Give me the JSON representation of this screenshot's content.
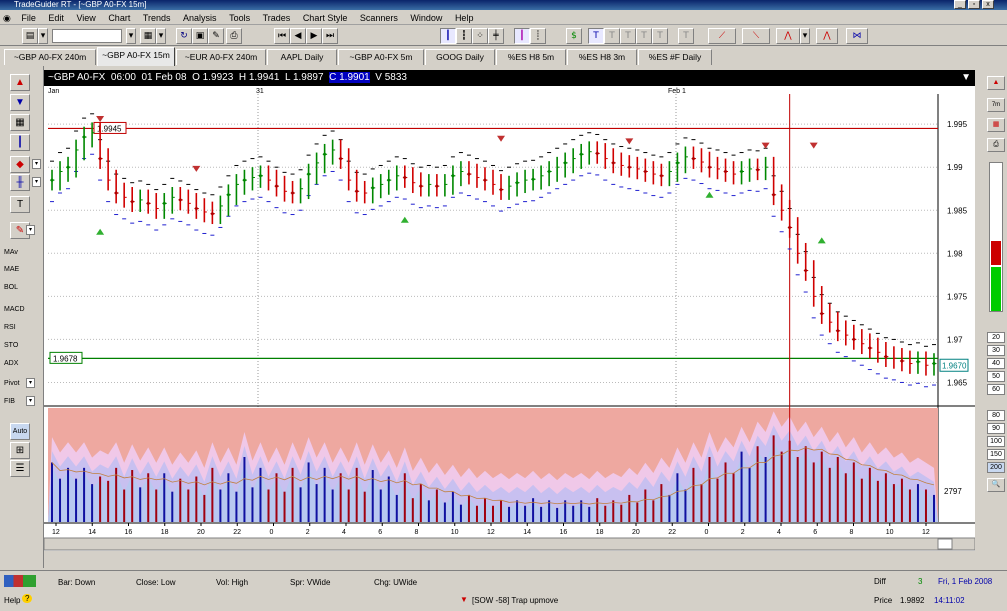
{
  "window": {
    "title": "TradeGuider RT - [~GBP A0-FX 15m]",
    "minimize": "_",
    "restore": "▫",
    "close": "x"
  },
  "menu": [
    "File",
    "Edit",
    "View",
    "Chart",
    "Trends",
    "Analysis",
    "Tools",
    "Trades",
    "Chart Style",
    "Scanners",
    "Window",
    "Help"
  ],
  "toolbar": {
    "symbol_value": ""
  },
  "tabs": [
    "~GBP A0-FX 240m",
    "~GBP A0-FX 15m",
    "~EUR A0-FX 240m",
    "AAPL Daily",
    "~GBP A0-FX 5m",
    "GOOG Daily",
    "%ES H8 5m",
    "%ES H8 3m",
    "%ES #F Daily"
  ],
  "active_tab": 1,
  "left_panel": {
    "items": [
      "MAv",
      "MAE",
      "BOL",
      "MACD",
      "RSI",
      "STO",
      "ADX",
      "Pivot",
      "FIB",
      "Auto"
    ]
  },
  "chart_header": {
    "symbol": "~GBP A0-FX",
    "time": "06:00",
    "date": "01 Feb 08",
    "open": "O 1.9923",
    "high": "H 1.9941",
    "low": "L 1.9897",
    "close": "C 1.9901",
    "volume": "V 5833"
  },
  "right_panel": {
    "zoom_label": "7m",
    "numbers_top": [
      "20",
      "30",
      "40",
      "50",
      "60"
    ],
    "numbers_bottom": [
      "80",
      "90",
      "100",
      "150",
      "200"
    ]
  },
  "chart_data": {
    "type": "candlestick",
    "date_labels": [
      "Jan",
      "31",
      "Feb 1"
    ],
    "x_ticks": [
      "12",
      "14",
      "16",
      "18",
      "20",
      "22",
      "0",
      "2",
      "4",
      "6",
      "8",
      "10",
      "12",
      "14",
      "16",
      "18",
      "20",
      "22",
      "0",
      "2",
      "4",
      "6",
      "8",
      "10",
      "12"
    ],
    "y_ticks": [
      "1.995",
      "1.99",
      "1.985",
      "1.98",
      "1.975",
      "1.97",
      "1.965"
    ],
    "ylim": [
      1.9625,
      1.9985
    ],
    "resistance": {
      "value": 1.9945,
      "label": "1.9945"
    },
    "support": {
      "value": 1.9678,
      "label": "1.9678"
    },
    "last_price_label": "1.9670",
    "volume_axis_label": "2797",
    "closes": [
      1.9885,
      1.9895,
      1.99,
      1.992,
      1.9935,
      1.994,
      1.991,
      1.9885,
      1.987,
      1.9865,
      1.986,
      1.9862,
      1.9858,
      1.9852,
      1.9858,
      1.9865,
      1.9862,
      1.9858,
      1.9852,
      1.9848,
      1.9846,
      1.9855,
      1.9868,
      1.988,
      1.9885,
      1.9888,
      1.989,
      1.9885,
      1.9878,
      1.9872,
      1.987,
      1.9875,
      1.9892,
      1.9905,
      1.9915,
      1.992,
      1.991,
      1.9885,
      1.9872,
      1.987,
      1.9876,
      1.988,
      1.9885,
      1.989,
      1.9888,
      1.9882,
      1.9878,
      1.988,
      1.9878,
      1.988,
      1.989,
      1.9895,
      1.9892,
      1.9888,
      1.9885,
      1.988,
      1.9874,
      1.9878,
      1.9882,
      1.9885,
      1.9886,
      1.989,
      1.9895,
      1.99,
      1.9905,
      1.991,
      1.9915,
      1.9918,
      1.9916,
      1.991,
      1.9905,
      1.9902,
      1.99,
      1.9898,
      1.9895,
      1.9892,
      1.989,
      1.9895,
      1.9905,
      1.9912,
      1.991,
      1.9906,
      1.99,
      1.9898,
      1.9895,
      1.9892,
      1.9895,
      1.9898,
      1.9897,
      1.99,
      1.9868,
      1.985,
      1.983,
      1.98,
      1.978,
      1.975,
      1.973,
      1.972,
      1.971,
      1.9705,
      1.97,
      1.9695,
      1.969,
      1.9685,
      1.968,
      1.9678,
      1.9675,
      1.9672,
      1.9674,
      1.967,
      1.9672
    ],
    "volumes": [
      0.55,
      0.4,
      0.5,
      0.4,
      0.5,
      0.35,
      0.42,
      0.38,
      0.5,
      0.3,
      0.48,
      0.32,
      0.45,
      0.3,
      0.45,
      0.28,
      0.4,
      0.3,
      0.42,
      0.25,
      0.5,
      0.3,
      0.45,
      0.28,
      0.6,
      0.32,
      0.5,
      0.3,
      0.45,
      0.28,
      0.5,
      0.32,
      0.55,
      0.35,
      0.5,
      0.3,
      0.45,
      0.3,
      0.5,
      0.28,
      0.48,
      0.3,
      0.42,
      0.25,
      0.45,
      0.22,
      0.35,
      0.2,
      0.3,
      0.18,
      0.28,
      0.16,
      0.25,
      0.15,
      0.22,
      0.15,
      0.2,
      0.14,
      0.2,
      0.15,
      0.22,
      0.14,
      0.2,
      0.13,
      0.2,
      0.15,
      0.2,
      0.14,
      0.22,
      0.15,
      0.2,
      0.16,
      0.25,
      0.18,
      0.3,
      0.2,
      0.35,
      0.25,
      0.45,
      0.3,
      0.5,
      0.35,
      0.6,
      0.4,
      0.55,
      0.45,
      0.65,
      0.5,
      0.7,
      0.6,
      0.8,
      0.65,
      0.75,
      0.6,
      0.7,
      0.55,
      0.65,
      0.5,
      0.6,
      0.45,
      0.55,
      0.4,
      0.5,
      0.38,
      0.45,
      0.35,
      0.4,
      0.3,
      0.35,
      0.3,
      0.25
    ]
  },
  "status": {
    "help": "Help",
    "bar": "Bar: Down",
    "close": "Close: Low",
    "vol": "Vol: High",
    "spr": "Spr: VWide",
    "chg": "Chg: UWide",
    "signal": "[SOW -58] Trap upmove",
    "diff_label": "Diff",
    "diff_value": "3",
    "price_label": "Price",
    "price_value": "1.9892",
    "date": "Fri, 1 Feb 2008",
    "time": "14:11:02"
  }
}
